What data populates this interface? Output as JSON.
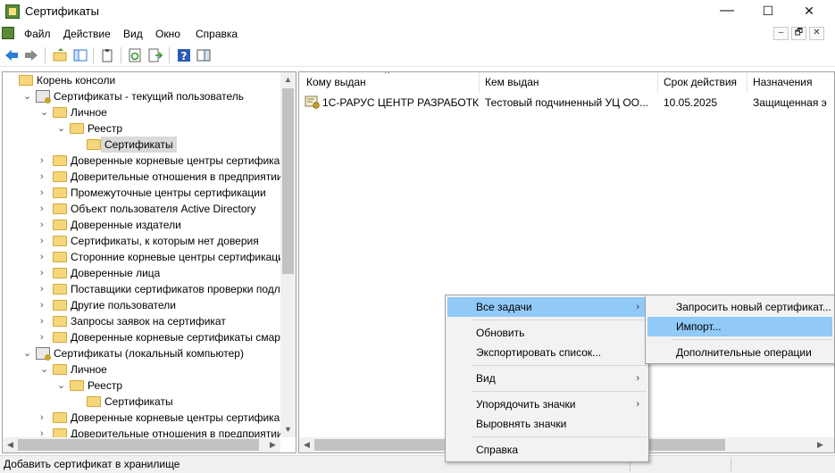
{
  "window": {
    "title": "Сертификаты",
    "min": "—",
    "max": "☐",
    "close": "✕"
  },
  "menu": {
    "items": [
      "Файл",
      "Действие",
      "Вид",
      "Окно",
      "Справка"
    ],
    "mdi": [
      "–",
      "🗗",
      "✕"
    ]
  },
  "tree": [
    {
      "label": "Корень консоли",
      "caret": "",
      "icon": "folder-icon"
    },
    {
      "label": "Сертификаты - текущий пользователь",
      "caret": "⌄",
      "icon": "certificate-store-icon"
    },
    {
      "label": "Личное",
      "caret": "⌄",
      "icon": "folder-icon"
    },
    {
      "label": "Реестр",
      "caret": "⌄",
      "icon": "folder-icon"
    },
    {
      "label": "Сертификаты",
      "caret": "",
      "icon": "folder-icon",
      "selected": true
    },
    {
      "label": "Доверенные корневые центры сертификации",
      "caret": "›",
      "icon": "folder-icon"
    },
    {
      "label": "Доверительные отношения в предприятии",
      "caret": "›",
      "icon": "folder-icon"
    },
    {
      "label": "Промежуточные центры сертификации",
      "caret": "›",
      "icon": "folder-icon"
    },
    {
      "label": "Объект пользователя Active Directory",
      "caret": "›",
      "icon": "folder-icon"
    },
    {
      "label": "Доверенные издатели",
      "caret": "›",
      "icon": "folder-icon"
    },
    {
      "label": "Сертификаты, к которым нет доверия",
      "caret": "›",
      "icon": "folder-icon"
    },
    {
      "label": "Сторонние корневые центры сертификации",
      "caret": "›",
      "icon": "folder-icon"
    },
    {
      "label": "Доверенные лица",
      "caret": "›",
      "icon": "folder-icon"
    },
    {
      "label": "Поставщики сертификатов проверки подлин",
      "caret": "›",
      "icon": "folder-icon"
    },
    {
      "label": "Другие пользователи",
      "caret": "›",
      "icon": "folder-icon"
    },
    {
      "label": "Запросы заявок на сертификат",
      "caret": "›",
      "icon": "folder-icon"
    },
    {
      "label": "Доверенные корневые сертификаты смарт-к",
      "caret": "›",
      "icon": "folder-icon"
    },
    {
      "label": "Сертификаты (локальный компьютер)",
      "caret": "⌄",
      "icon": "certificate-store-icon"
    },
    {
      "label": "Личное",
      "caret": "⌄",
      "icon": "folder-icon"
    },
    {
      "label": "Реестр",
      "caret": "⌄",
      "icon": "folder-icon"
    },
    {
      "label": "Сертификаты",
      "caret": "",
      "icon": "folder-icon"
    },
    {
      "label": "Доверенные корневые центры сертификации",
      "caret": "›",
      "icon": "folder-icon"
    },
    {
      "label": "Доверительные отношения в предприятии",
      "caret": "›",
      "icon": "folder-icon"
    }
  ],
  "list": {
    "columns": [
      "Кому выдан",
      "Кем выдан",
      "Срок действия",
      "Назначения"
    ],
    "rows": [
      {
        "issued_to": "1С-РАРУС ЦЕНТР РАЗРАБОТКИ",
        "issued_by": "Тестовый подчиненный УЦ ОО...",
        "expires": "10.05.2025",
        "purpose": "Защищенная э"
      }
    ]
  },
  "context_menu": {
    "items": [
      "Все задачи",
      "Обновить",
      "Экспортировать список...",
      "Вид",
      "Упорядочить значки",
      "Выровнять значки",
      "Справка"
    ],
    "arrow": "›"
  },
  "submenu": {
    "items": [
      "Запросить новый сертификат...",
      "Импорт...",
      "Дополнительные операции"
    ]
  },
  "status": {
    "text": "Добавить сертификат в хранилище"
  },
  "colors": {
    "highlight": "#91c9f7",
    "selection": "#d9d9d9",
    "folder": "#f5d67a",
    "back_arrow": "#2e7bd6"
  }
}
